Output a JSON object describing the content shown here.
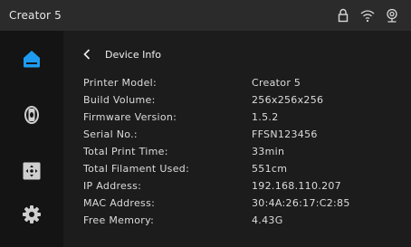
{
  "status_bar": {
    "title": "Creator 5",
    "icons": [
      "lock-icon",
      "wifi-icon",
      "camera-icon"
    ]
  },
  "sidebar": {
    "items": [
      {
        "icon": "home-icon",
        "active": true
      },
      {
        "icon": "filament-icon",
        "active": false
      },
      {
        "icon": "calibration-icon",
        "active": false
      },
      {
        "icon": "settings-gear-icon",
        "active": false
      }
    ]
  },
  "page": {
    "title": "Device Info",
    "back_icon": "chevron-left-icon"
  },
  "info": [
    {
      "label": "Printer Model:",
      "value": "Creator 5"
    },
    {
      "label": "Build Volume:",
      "value": "256x256x256"
    },
    {
      "label": "Firmware Version:",
      "value": "1.5.2"
    },
    {
      "label": "Serial No.:",
      "value": "FFSN123456"
    },
    {
      "label": "Total Print Time:",
      "value": "33min"
    },
    {
      "label": "Total Filament Used:",
      "value": "551cm"
    },
    {
      "label": "IP Address:",
      "value": "192.168.110.207"
    },
    {
      "label": "MAC Address:",
      "value": "30:4A:26:17:C2:85"
    },
    {
      "label": "Free Memory:",
      "value": "4.43G"
    }
  ],
  "colors": {
    "accent": "#1e9bf0",
    "topbar_bg": "#2b2b2b",
    "sidebar_bg": "#141414",
    "content_bg": "#1c1c1c"
  }
}
